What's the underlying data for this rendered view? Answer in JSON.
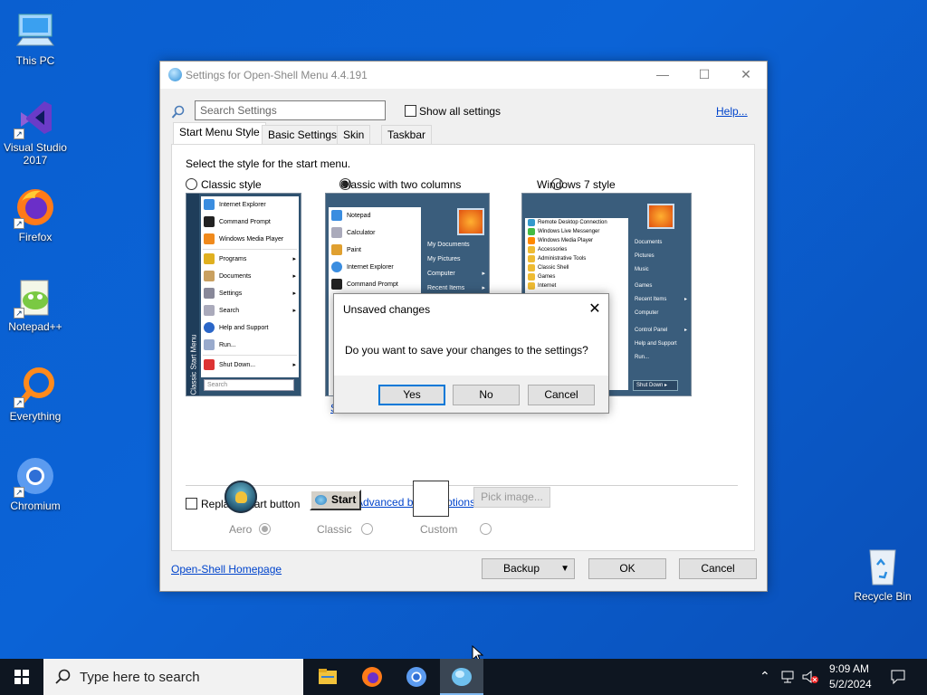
{
  "desktop": {
    "icons": [
      {
        "label": "This PC",
        "icon": "this-pc-icon"
      },
      {
        "label": "Visual Studio 2017",
        "icon": "visual-studio-icon"
      },
      {
        "label": "Firefox",
        "icon": "firefox-icon"
      },
      {
        "label": "Notepad++",
        "icon": "notepad-plus-plus-icon"
      },
      {
        "label": "Everything",
        "icon": "everything-icon"
      },
      {
        "label": "Chromium",
        "icon": "chromium-icon"
      }
    ],
    "recycle_bin": "Recycle Bin"
  },
  "window": {
    "title": "Settings for Open-Shell Menu 4.4.191",
    "search_placeholder": "Search Settings",
    "show_all": "Show all settings",
    "help": "Help...",
    "tabs": [
      "Start Menu Style",
      "Basic Settings",
      "Skin",
      "Taskbar"
    ],
    "select_style_label": "Select the style for the start menu.",
    "styles": [
      "Classic style",
      "Classic with two columns",
      "Windows 7 style"
    ],
    "selected_style": "Classic with two columns",
    "replace_start": "Replace Start button",
    "advanced_options": "Advanced button options...",
    "button_styles": [
      "Aero",
      "Classic",
      "Custom"
    ],
    "classic_start_label": "Start",
    "pick_image": "Pick image...",
    "homepage": "Open-Shell Homepage",
    "backup": "Backup",
    "ok": "OK",
    "cancel": "Cancel",
    "hidden_link_fragment": "S"
  },
  "previews": {
    "classic": {
      "items": [
        "Internet Explorer",
        "Command Prompt",
        "Windows Media Player",
        "Programs",
        "Documents",
        "Settings",
        "Search",
        "Help and Support",
        "Run...",
        "Shut Down..."
      ],
      "sidebar": "Classic Start Menu",
      "search": "Search"
    },
    "two_columns": {
      "left_items": [
        "Notepad",
        "Calculator",
        "Paint",
        "Internet Explorer",
        "Command Prompt"
      ],
      "right_items": [
        "My Documents",
        "My Pictures",
        "Computer",
        "Recent Items"
      ]
    },
    "win7": {
      "left_items": [
        "Remote Desktop Connection",
        "Windows Live Messenger",
        "Windows Media Player",
        "Accessories",
        "Administrative Tools",
        "Classic Shell",
        "Games",
        "Internet"
      ],
      "right_items": [
        "Documents",
        "Pictures",
        "Music",
        "Games",
        "Recent Items",
        "Computer",
        "Control Panel",
        "Help and Support",
        "Run..."
      ],
      "shutdown": "Shut Down"
    }
  },
  "dialog": {
    "title": "Unsaved changes",
    "message": "Do you want to save your changes to the settings?",
    "yes": "Yes",
    "no": "No",
    "cancel": "Cancel"
  },
  "taskbar": {
    "search_placeholder": "Type here to search",
    "time": "9:09 AM",
    "date": "5/2/2024"
  }
}
